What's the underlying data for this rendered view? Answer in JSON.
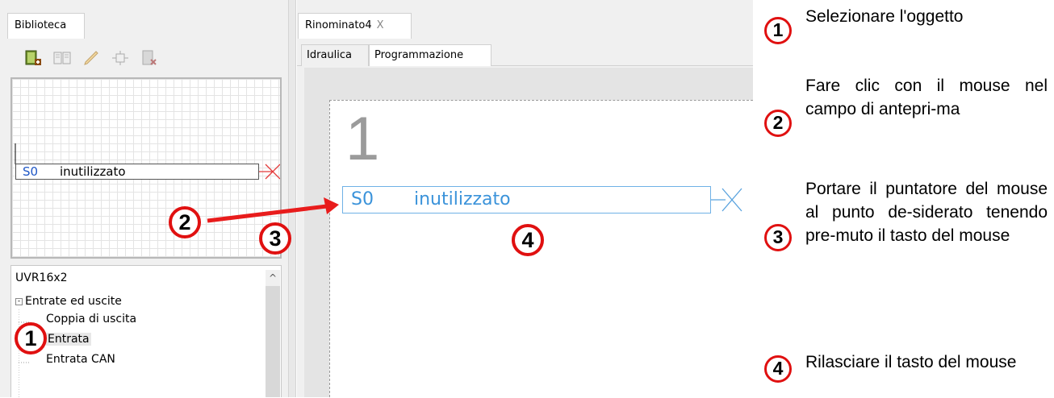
{
  "library": {
    "tab_label": "Biblioteca",
    "preview": {
      "number": "S0",
      "label": "inutilizzato"
    },
    "tree": {
      "root": "UVR16x2",
      "group": "Entrate ed uscite",
      "items": [
        "Coppia di uscita",
        "Entrata",
        "Entrata CAN"
      ]
    },
    "scroll_up": "^"
  },
  "editor": {
    "doc_tab": "Rinominato4",
    "doc_close": "X",
    "subtabs": [
      "Idraulica",
      "Programmazione"
    ],
    "big_number": "1",
    "block": {
      "number": "S0",
      "label": "inutilizzato"
    }
  },
  "badges": [
    "1",
    "2",
    "3",
    "4"
  ],
  "instructions": [
    "Selezionare l'oggetto",
    "Fare clic con il mouse nel campo di antepri-ma",
    "Portare il puntatore del mouse al punto de-siderato tenendo pre-muto il tasto del mouse",
    "Rilasciare il tasto del mouse"
  ],
  "icons": [
    "add-book-icon",
    "read-book-icon",
    "pencil-icon",
    "connector-icon",
    "delete-book-icon",
    "close-icon",
    "arrow-icon"
  ],
  "colors": {
    "badge_border": "#e01010",
    "block_blue": "#3b93da",
    "arrow_red": "#e81c1c"
  }
}
